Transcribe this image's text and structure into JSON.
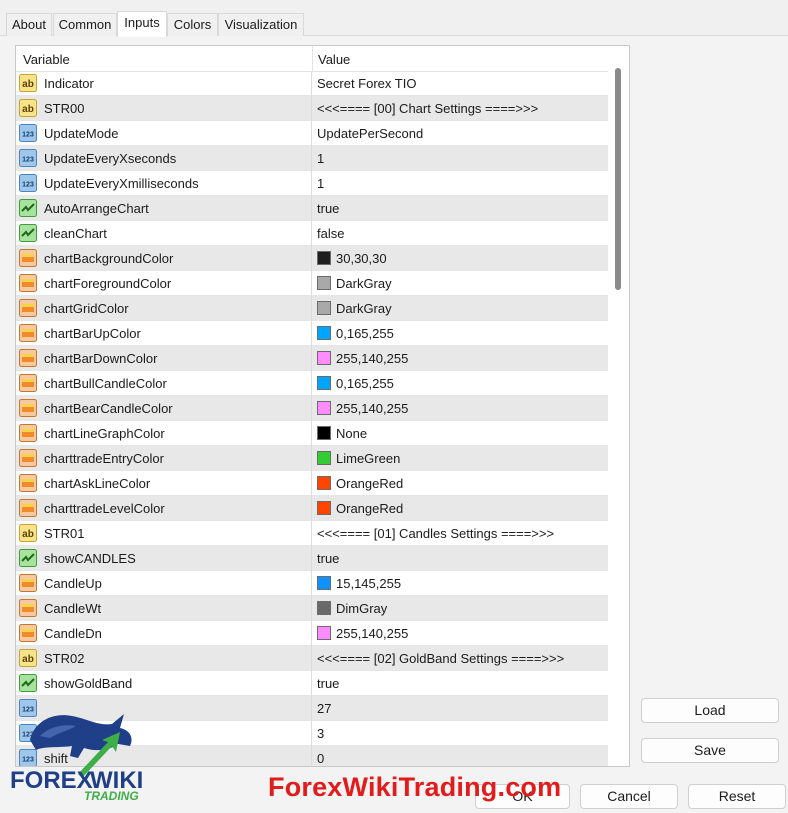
{
  "tabs": [
    {
      "label": "About",
      "active": false
    },
    {
      "label": "Common",
      "active": false
    },
    {
      "label": "Inputs",
      "active": true
    },
    {
      "label": "Colors",
      "active": false
    },
    {
      "label": "Visualization",
      "active": false
    }
  ],
  "grid": {
    "col_variable": "Variable",
    "col_value": "Value",
    "rows": [
      {
        "type": "string",
        "name": "Indicator",
        "value": "Secret Forex TIO"
      },
      {
        "type": "string",
        "name": "STR00",
        "value": "<<<==== [00] Chart Settings ====>>>"
      },
      {
        "type": "int",
        "name": "UpdateMode",
        "value": "UpdatePerSecond"
      },
      {
        "type": "int",
        "name": "UpdateEveryXseconds",
        "value": "1"
      },
      {
        "type": "int",
        "name": "UpdateEveryXmilliseconds",
        "value": "1"
      },
      {
        "type": "bool",
        "name": "AutoArrangeChart",
        "value": "true"
      },
      {
        "type": "bool",
        "name": "cleanChart",
        "value": "false"
      },
      {
        "type": "color",
        "name": "chartBackgroundColor",
        "value": "30,30,30",
        "swatch": "#1e1e1e"
      },
      {
        "type": "color",
        "name": "chartForegroundColor",
        "value": "DarkGray",
        "swatch": "#a9a9a9"
      },
      {
        "type": "color",
        "name": "chartGridColor",
        "value": "DarkGray",
        "swatch": "#a9a9a9"
      },
      {
        "type": "color",
        "name": "chartBarUpColor",
        "value": "0,165,255",
        "swatch": "#00a5ff"
      },
      {
        "type": "color",
        "name": "chartBarDownColor",
        "value": "255,140,255",
        "swatch": "#ff8cff"
      },
      {
        "type": "color",
        "name": "chartBullCandleColor",
        "value": "0,165,255",
        "swatch": "#00a5ff"
      },
      {
        "type": "color",
        "name": "chartBearCandleColor",
        "value": "255,140,255",
        "swatch": "#ff8cff"
      },
      {
        "type": "color",
        "name": "chartLineGraphColor",
        "value": "None",
        "swatch": "#000000"
      },
      {
        "type": "color",
        "name": "charttradeEntryColor",
        "value": "LimeGreen",
        "swatch": "#32cd32"
      },
      {
        "type": "color",
        "name": "chartAskLineColor",
        "value": "OrangeRed",
        "swatch": "#ff4500"
      },
      {
        "type": "color",
        "name": "charttradeLevelColor",
        "value": "OrangeRed",
        "swatch": "#ff4500"
      },
      {
        "type": "string",
        "name": "STR01",
        "value": "<<<==== [01] Candles Settings ====>>>"
      },
      {
        "type": "bool",
        "name": "showCANDLES",
        "value": "true"
      },
      {
        "type": "color",
        "name": "CandleUp",
        "value": "15,145,255",
        "swatch": "#0f91ff"
      },
      {
        "type": "color",
        "name": "CandleWt",
        "value": "DimGray",
        "swatch": "#696969"
      },
      {
        "type": "color",
        "name": "CandleDn",
        "value": "255,140,255",
        "swatch": "#ff8cff"
      },
      {
        "type": "string",
        "name": "STR02",
        "value": "<<<==== [02] GoldBand Settings ====>>>"
      },
      {
        "type": "bool",
        "name": "showGoldBand",
        "value": "true"
      },
      {
        "type": "int",
        "name": "",
        "value": "27"
      },
      {
        "type": "int",
        "name": "Sh",
        "value": "3"
      },
      {
        "type": "int",
        "name": "shift",
        "value": "0"
      }
    ]
  },
  "buttons": {
    "load": "Load",
    "save": "Save",
    "ok": "OK",
    "cancel": "Cancel",
    "reset": "Reset"
  },
  "icon_names": {
    "string": "ab-string-icon",
    "int": "123-integer-icon",
    "bool": "boolean-check-icon",
    "color": "color-palette-icon"
  },
  "watermark": {
    "logo_text_1": "FOREX",
    "logo_text_2": "WIKI",
    "logo_text_3": "TRADING",
    "site": "ForexWikiTrading.com"
  }
}
